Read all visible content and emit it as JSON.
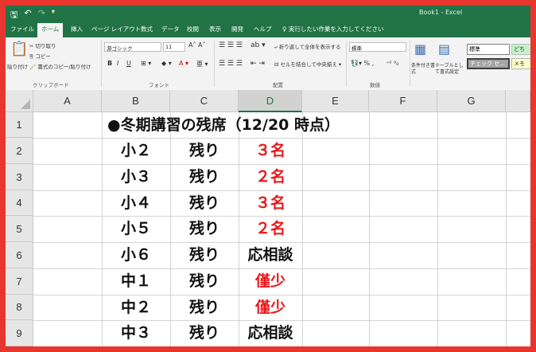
{
  "window": {
    "title": "Book1 - Excel",
    "quick_access": [
      "save-icon",
      "undo-icon",
      "redo-icon",
      "customize-icon"
    ]
  },
  "tabs": [
    "ファイル",
    "ホーム",
    "挿入",
    "ページ レイアウト",
    "数式",
    "データ",
    "校閲",
    "表示",
    "開発",
    "ヘルプ"
  ],
  "active_tab": "ホーム",
  "tell_me": "実行したい作業を入力してください",
  "ribbon": {
    "clipboard": {
      "paste": "貼り付け",
      "cut": "切り取り",
      "copy": "コピー",
      "format_painter": "書式のコピー/貼り付け",
      "group": "クリップボード"
    },
    "font": {
      "name": "游ゴシック",
      "size": "11",
      "bold": "B",
      "italic": "I",
      "underline": "U",
      "group": "フォント"
    },
    "alignment": {
      "wrap": "折り返して全体を表示する",
      "merge": "セルを結合して中央揃え",
      "group": "配置"
    },
    "number": {
      "format": "標準",
      "group": "数値"
    },
    "styles": {
      "conditional": "条件付き書式",
      "table": "テーブルとして書式設定",
      "normal": "標準",
      "good": "どち",
      "check": "チェック セ...",
      "memo": "メモ"
    }
  },
  "sheet": {
    "columns": [
      "A",
      "B",
      "C",
      "D",
      "E",
      "F",
      "G"
    ],
    "selected_column": "D",
    "rows": [
      "1",
      "2",
      "3",
      "4",
      "5",
      "6",
      "7",
      "8",
      "9"
    ],
    "title": "●冬期講習の残席（12/20 時点）",
    "entries": [
      {
        "grade": "小２",
        "label": "残り",
        "seats": "３名",
        "color": "#e8161b"
      },
      {
        "grade": "小３",
        "label": "残り",
        "seats": "２名",
        "color": "#e8161b"
      },
      {
        "grade": "小４",
        "label": "残り",
        "seats": "３名",
        "color": "#e8161b"
      },
      {
        "grade": "小５",
        "label": "残り",
        "seats": "２名",
        "color": "#e8161b"
      },
      {
        "grade": "小６",
        "label": "残り",
        "seats": "応相談",
        "color": "#111111"
      },
      {
        "grade": "中１",
        "label": "残り",
        "seats": "僅少",
        "color": "#e8161b"
      },
      {
        "grade": "中２",
        "label": "残り",
        "seats": "僅少",
        "color": "#e8161b"
      },
      {
        "grade": "中３",
        "label": "残り",
        "seats": "応相談",
        "color": "#111111"
      }
    ]
  },
  "colors": {
    "excel_green": "#217346",
    "frame_red": "#e8362e",
    "accent_red": "#e8161b"
  }
}
